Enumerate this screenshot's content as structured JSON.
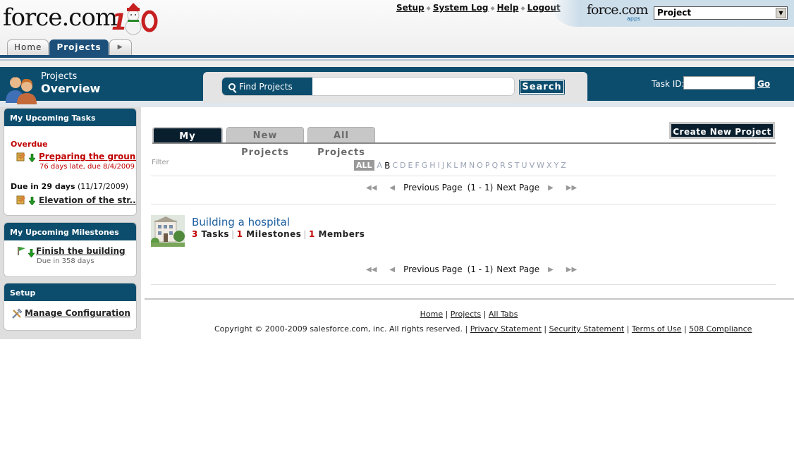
{
  "header": {
    "logo_text": "force.com",
    "top_links": [
      "Setup",
      "System Log",
      "Help",
      "Logout"
    ],
    "apps_logo": "force.com",
    "apps_sub": "apps",
    "app_selector_value": "Project"
  },
  "tabs": [
    {
      "label": "Home",
      "active": false
    },
    {
      "label": "Projects",
      "active": true
    }
  ],
  "banner": {
    "title_line1": "Projects",
    "title_line2": "Overview",
    "find_label": "Find Projects",
    "find_value": "",
    "search_button": "Search",
    "task_id_label": "Task ID:",
    "task_id_value": "",
    "go_label": "Go"
  },
  "sidebar": {
    "upcoming_tasks": {
      "header": "My Upcoming Tasks",
      "overdue_label": "Overdue",
      "overdue_task": {
        "name": "Preparing the ground",
        "detail": "76 days late, due 8/4/2009"
      },
      "due_label": "Due in 29 days",
      "due_date": "(11/17/2009)",
      "due_task": {
        "name": "Elevation of the str..."
      }
    },
    "upcoming_milestones": {
      "header": "My Upcoming Milestones",
      "milestone": {
        "name": "Finish the building",
        "detail": "Due in 358 days"
      }
    },
    "setup": {
      "header": "Setup",
      "link": "Manage Configuration"
    }
  },
  "main": {
    "project_tabs": [
      "My Projects",
      "New Projects",
      "All Projects"
    ],
    "create_button": "Create New Project",
    "filter_label": "Filter",
    "alpha_all": "ALL",
    "alpha_letters": [
      "A",
      "B",
      "C",
      "D",
      "E",
      "F",
      "G",
      "H",
      "I",
      "J",
      "K",
      "L",
      "M",
      "N",
      "O",
      "P",
      "Q",
      "R",
      "S",
      "T",
      "U",
      "V",
      "W",
      "X",
      "Y",
      "Z"
    ],
    "pager": {
      "prev": "Previous Page",
      "range": "(1 - 1)",
      "next": "Next Page"
    },
    "project": {
      "title": "Building a hospital",
      "tasks_count": "3",
      "tasks_label": "Tasks",
      "milestones_count": "1",
      "milestones_label": "Milestones",
      "members_count": "1",
      "members_label": "Members"
    }
  },
  "footer": {
    "links": [
      "Home",
      "Projects",
      "All Tabs"
    ],
    "copyright": "Copyright © 2000-2009 salesforce.com, inc. All rights reserved. |",
    "legal_links": [
      "Privacy Statement",
      "Security Statement",
      "Terms of Use",
      "508 Compliance"
    ]
  }
}
